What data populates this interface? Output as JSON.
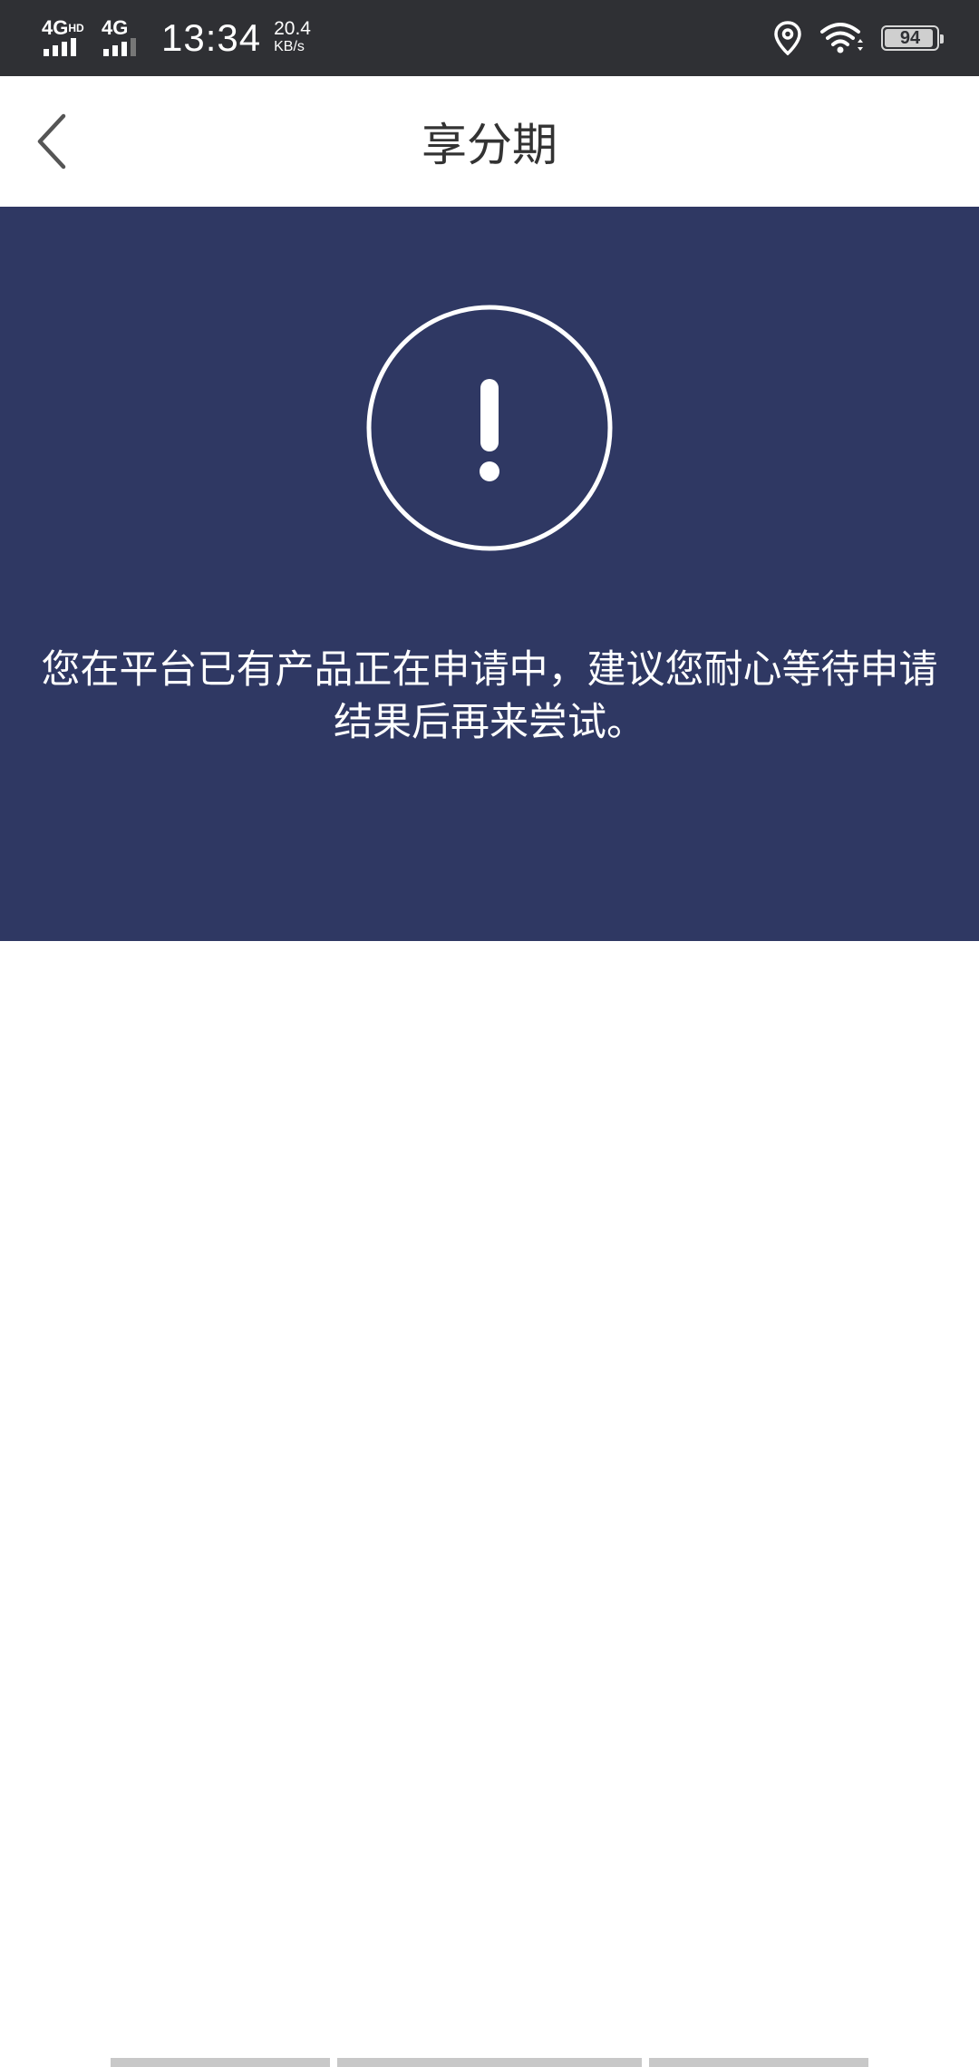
{
  "status_bar": {
    "sim1_label": "4G",
    "sim1_badge": "HD",
    "sim2_label": "4G",
    "time": "13:34",
    "net_speed_value": "20.4",
    "net_speed_unit": "KB/s",
    "battery_level": "94",
    "battery_fraction": 0.94
  },
  "nav": {
    "title": "享分期"
  },
  "banner": {
    "message": "您在平台已有产品正在申请中，建议您耐心等待申请结果后再来尝试。",
    "background_color": "#2f3863"
  }
}
